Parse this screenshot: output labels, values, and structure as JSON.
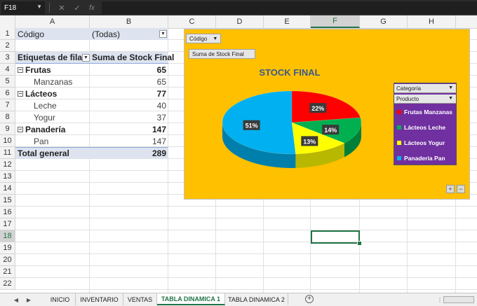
{
  "formula_bar": {
    "name_box": "F18",
    "cancel_icon": "✕",
    "enter_icon": "✓",
    "fx_label": "fx"
  },
  "columns": [
    "A",
    "B",
    "C",
    "D",
    "E",
    "F",
    "G",
    "H"
  ],
  "rows": [
    "1",
    "2",
    "3",
    "4",
    "5",
    "6",
    "7",
    "8",
    "9",
    "10",
    "11",
    "12",
    "13",
    "14",
    "15",
    "16",
    "17",
    "18",
    "19",
    "20",
    "21",
    "22"
  ],
  "pivot": {
    "filter_label": "Código",
    "filter_value": "(Todas)",
    "row_label_header": "Etiquetas de fila",
    "value_header": "Suma de Stock Final",
    "groups": [
      {
        "label": "Frutas",
        "value": "65",
        "items": [
          {
            "label": "Manzanas",
            "value": "65"
          }
        ]
      },
      {
        "label": "Lácteos",
        "value": "77",
        "items": [
          {
            "label": "Leche",
            "value": "40"
          },
          {
            "label": "Yogur",
            "value": "37"
          }
        ]
      },
      {
        "label": "Panadería",
        "value": "147",
        "items": [
          {
            "label": "Pan",
            "value": "147"
          }
        ]
      }
    ],
    "total_label": "Total general",
    "total_value": "289"
  },
  "chart": {
    "filter_button": "Código",
    "value_field_button": "Suma de Stock Final",
    "legend_filter_1": "Categoría",
    "legend_filter_2": "Producto",
    "zoom_in": "+",
    "zoom_out": "−",
    "colors": {
      "background": "#ffc000",
      "legend_bg": "#7030a0",
      "title": "#3a5a8c"
    }
  },
  "chart_data": {
    "type": "pie",
    "title": "STOCK FINAL",
    "labels": [
      "Frutas Manzanas",
      "Lácteos Leche",
      "Lácteos Yogur",
      "Panadería Pan"
    ],
    "values": [
      65,
      40,
      37,
      147
    ],
    "percent_labels": [
      "22%",
      "14%",
      "13%",
      "51%"
    ],
    "colors": [
      "#ff0000",
      "#00b050",
      "#ffff00",
      "#00b0f0"
    ],
    "legend_placement": "right"
  },
  "sheets": {
    "tabs": [
      "INICIO",
      "INVENTARIO",
      "VENTAS",
      "TABLA DINAMICA 1",
      "TABLA DINAMICA 2"
    ],
    "active": "TABLA DINAMICA 1",
    "add_label": "+"
  }
}
